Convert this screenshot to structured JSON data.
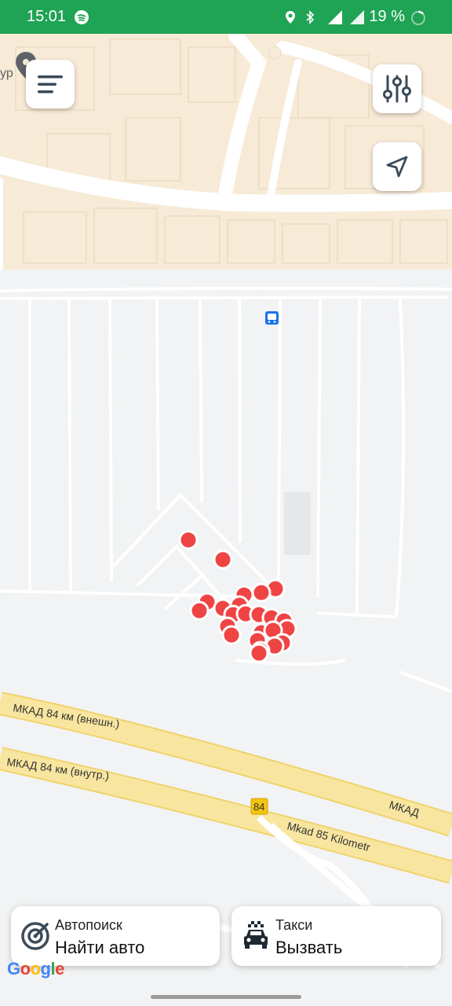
{
  "status_bar": {
    "time": "15:01",
    "battery": "19 %"
  },
  "map": {
    "road_labels": [
      "МКАД 84 км (внешн.)",
      "МКАД 84 км (внутр.)",
      "МКАД",
      "Mkad 85 Kilometr",
      "84"
    ],
    "partial_label": "ур",
    "attribution": "Google",
    "markers_count": 28
  },
  "buttons": {
    "autosearch": {
      "label": "Автопоиск",
      "action": "Найти авто",
      "icon": "radar-icon"
    },
    "taxi": {
      "label": "Такси",
      "action": "Вызвать",
      "icon": "taxi-car-icon"
    }
  },
  "colors": {
    "status_bar": "#1fa354",
    "marker": "#ef4444",
    "highway": "#f8e6a0",
    "buildings": "#f7ead6"
  }
}
